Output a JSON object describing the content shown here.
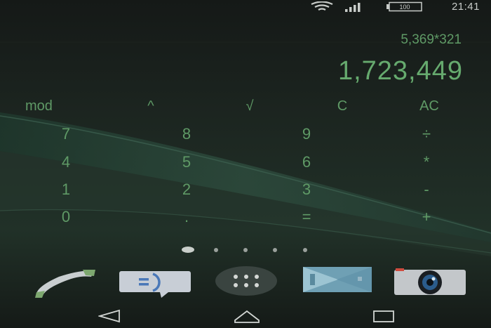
{
  "status_bar": {
    "time": "21:41",
    "battery": "100",
    "icons": [
      "wifi-icon",
      "signal-icon",
      "battery-icon"
    ]
  },
  "calculator": {
    "expression": "5,369*321",
    "result": "1,723,449",
    "function_keys": [
      "mod",
      "^",
      "√",
      "C",
      "AC"
    ],
    "keypad": [
      [
        "7",
        "8",
        "9",
        "÷"
      ],
      [
        "4",
        "5",
        "6",
        "*"
      ],
      [
        "1",
        "2",
        "3",
        "-"
      ],
      [
        "0",
        ".",
        "=",
        "+"
      ]
    ]
  },
  "home_pages": {
    "count": 5,
    "current": 1
  },
  "dock": {
    "apps": [
      "phone-icon",
      "messaging-icon",
      "app-drawer-icon",
      "video-icon",
      "camera-icon"
    ]
  },
  "nav_bar": {
    "buttons": [
      "back-icon",
      "home-icon",
      "recents-icon"
    ]
  },
  "colors": {
    "background": "#1b211d",
    "wallpaper_wave": "#2d4a3a",
    "calculator_text": "#5f9a66",
    "status_text": "#c8ccc9"
  }
}
